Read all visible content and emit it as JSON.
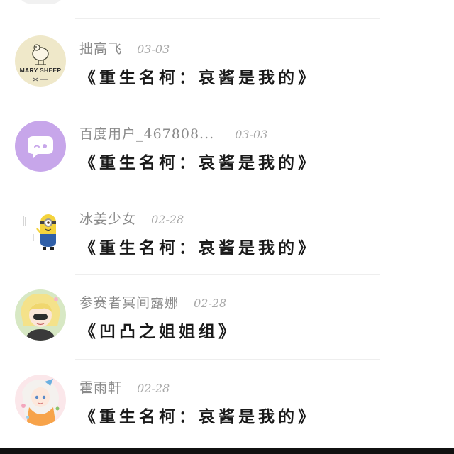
{
  "comments": [
    {
      "username": "拙高飞",
      "date": "03-03",
      "work_title": "《重生名柯：哀酱是我的》",
      "avatar": {
        "icon": "mary-sheep-logo",
        "text": "MARY SHEEP",
        "bg": "#efe8c9"
      }
    },
    {
      "username": "百度用户_467808...",
      "date": "03-03",
      "work_title": "《重生名柯：哀酱是我的》",
      "avatar": {
        "icon": "chat-bubble-icon",
        "bg": "#c7a6ea"
      }
    },
    {
      "username": "冰姜少女",
      "date": "02-28",
      "work_title": "《重生名柯：哀酱是我的》",
      "avatar": {
        "icon": "minion-icon",
        "bg": "#ffffff"
      }
    },
    {
      "username": "参赛者冥间露娜",
      "date": "02-28",
      "work_title": "《凹凸之姐姐组》",
      "avatar": {
        "icon": "anime-girl-icon",
        "bg": "#d7e8c4"
      }
    },
    {
      "username": "霍雨軒",
      "date": "02-28",
      "work_title": "《重生名柯：哀酱是我的》",
      "avatar": {
        "icon": "anime-character-icon",
        "bg": "#fbe7ea"
      }
    }
  ]
}
